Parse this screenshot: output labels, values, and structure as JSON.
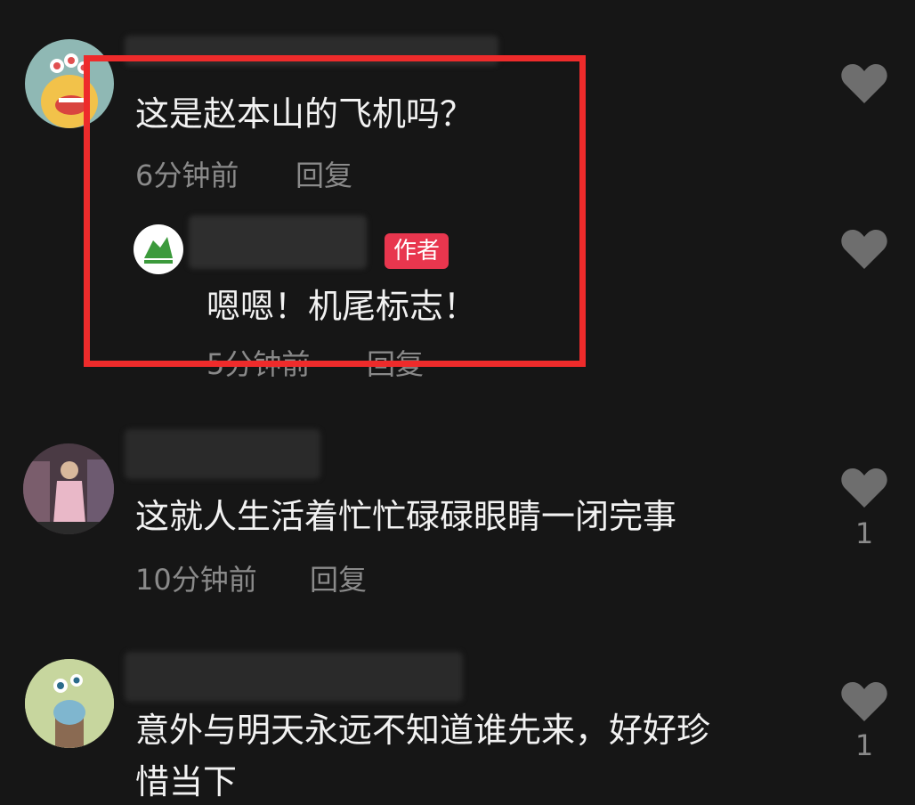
{
  "comments": [
    {
      "text": "这是赵本山的飞机吗？",
      "time": "6分钟前",
      "reply_label": "回复",
      "like_icon": "heart-icon",
      "like_count": "",
      "reply": {
        "badge": "作者",
        "text": "嗯嗯！机尾标志！",
        "time": "5分钟前",
        "reply_label": "回复",
        "like_icon": "heart-icon"
      }
    },
    {
      "text": "这就人生活着忙忙碌碌眼睛一闭完事",
      "time": "10分钟前",
      "reply_label": "回复",
      "like_icon": "heart-icon",
      "like_count": "1"
    },
    {
      "text_line1": "意外与明天永远不知道谁先来，好好珍",
      "text_line2": "惜当下",
      "like_icon": "heart-icon",
      "like_count": "1"
    }
  ],
  "colors": {
    "background": "#161616",
    "highlight_border": "#ee2b2b",
    "author_badge": "#e8364e",
    "muted_text": "#8a8a8a",
    "heart": "#6e6e6e"
  }
}
